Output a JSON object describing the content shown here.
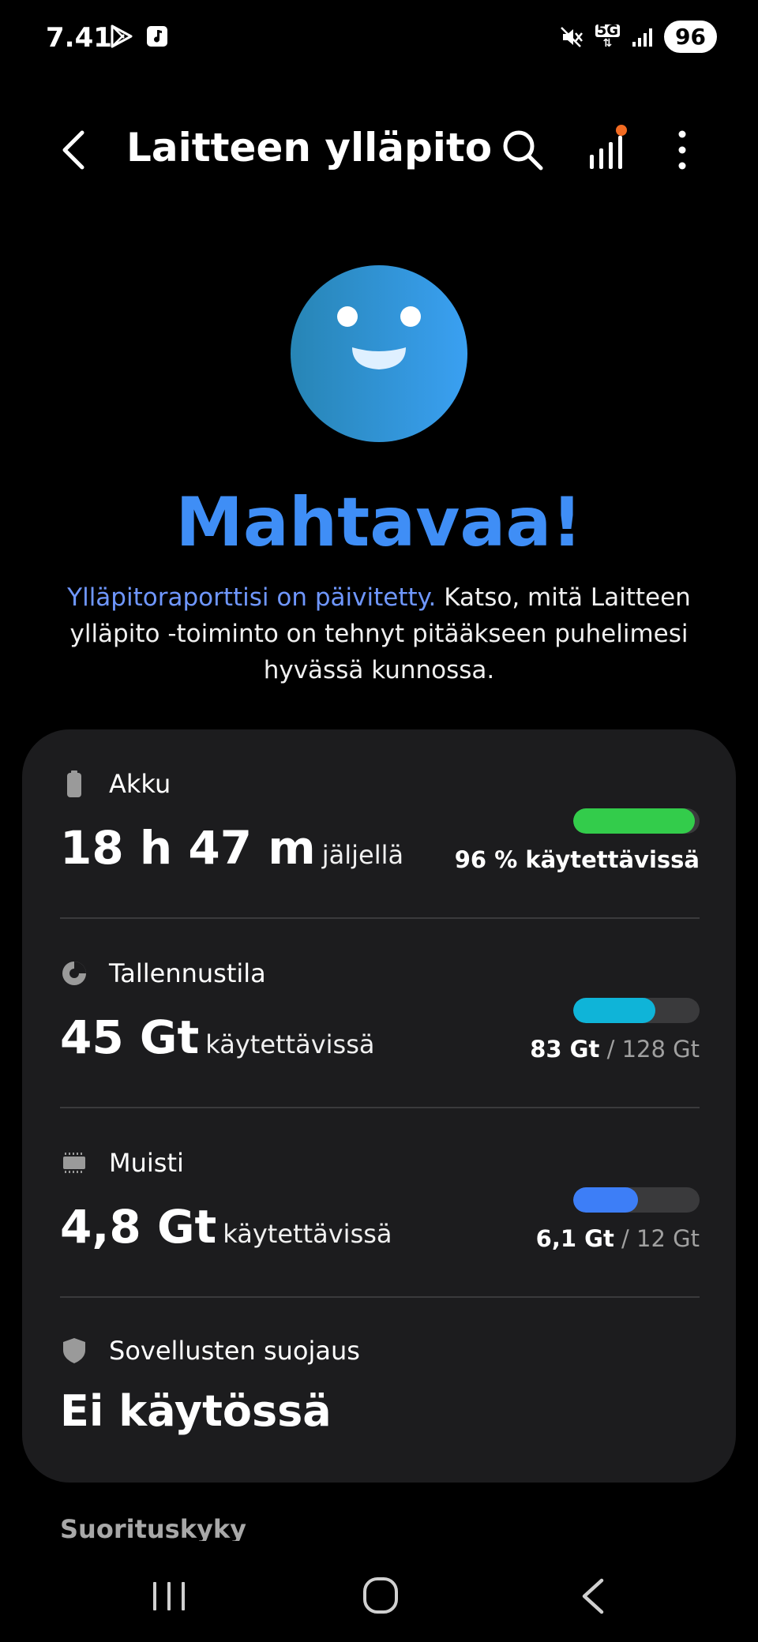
{
  "status_bar": {
    "time": "7.41",
    "battery": "96",
    "network": "5G"
  },
  "app_bar": {
    "title": "Laitteen ylläpito"
  },
  "hero": {
    "title": "Mahtavaa!",
    "link_text": "Ylläpitoraporttisi on päivitetty.",
    "desc_text": " Katso, mitä Laitteen ylläpito -toiminto on tehnyt pitääkseen puhelimesi hyvässä kunnossa."
  },
  "sections": {
    "battery": {
      "label": "Akku",
      "value": "18 h 47 m",
      "value_suffix": "jäljellä",
      "caption": "96 % käytettävissä",
      "fill": 0.96,
      "color": "#33cc4b"
    },
    "storage": {
      "label": "Tallennustila",
      "value": "45 Gt",
      "value_suffix": "käytettävissä",
      "caption_used": "83 Gt",
      "caption_sep": " / ",
      "caption_total": "128 Gt",
      "fill": 0.65,
      "color": "#0fb4d8"
    },
    "memory": {
      "label": "Muisti",
      "value": "4,8 Gt",
      "value_suffix": "käytettävissä",
      "caption_used": "6,1 Gt",
      "caption_sep": " / ",
      "caption_total": "12 Gt",
      "fill": 0.51,
      "color": "#3d7ef7"
    },
    "app_protection": {
      "label": "Sovellusten suojaus",
      "value": "Ei käytössä"
    }
  },
  "next_section": {
    "heading": "Suorituskyky"
  },
  "colors": {
    "accent": "#3f8ef6",
    "link": "#6f97ff",
    "card_bg": "#1c1c1e",
    "face_start": "#2785b5",
    "face_end": "#3aa0f2",
    "notification_dot": "#f26b22"
  }
}
